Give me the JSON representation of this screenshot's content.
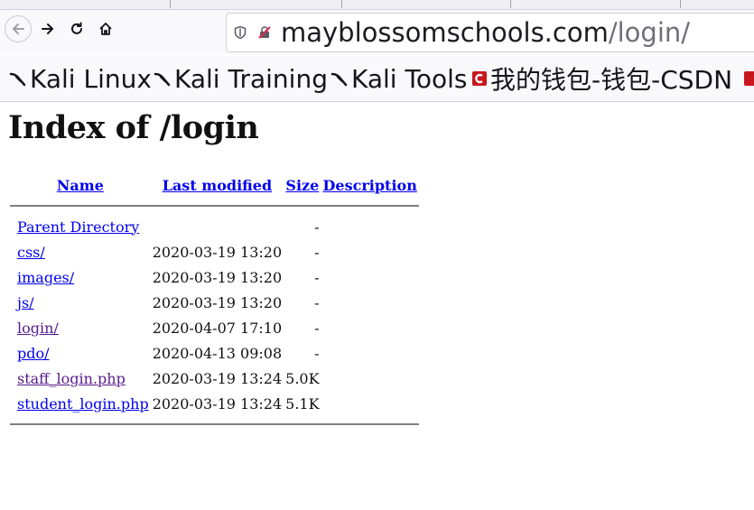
{
  "browser": {
    "url_host": "mayblossomschools.com",
    "url_path": "/login/",
    "bookmarks": [
      {
        "label": "Kali Linux",
        "icon": "kali-dragon-icon"
      },
      {
        "label": "Kali Training",
        "icon": "kali-dragon-icon"
      },
      {
        "label": "Kali Tools",
        "icon": "kali-dragon-icon"
      },
      {
        "label": "我的钱包-钱包-CSDN",
        "icon": "csdn-icon"
      }
    ],
    "colors": {
      "link": "#0000ee",
      "visited": "#551a8b",
      "csdn_red": "#c8161d"
    }
  },
  "page": {
    "title": "Index of /login",
    "columns": {
      "name": "Name",
      "modified": "Last modified",
      "size": "Size",
      "description": "Description"
    },
    "rows": [
      {
        "name": "Parent Directory",
        "modified": "",
        "size": "-",
        "description": ""
      },
      {
        "name": "css/",
        "modified": "2020-03-19 13:20",
        "size": "-",
        "description": ""
      },
      {
        "name": "images/",
        "modified": "2020-03-19 13:20",
        "size": "-",
        "description": ""
      },
      {
        "name": "js/",
        "modified": "2020-03-19 13:20",
        "size": "-",
        "description": ""
      },
      {
        "name": "login/",
        "modified": "2020-04-07 17:10",
        "size": "-",
        "description": ""
      },
      {
        "name": "pdo/",
        "modified": "2020-04-13 09:08",
        "size": "-",
        "description": ""
      },
      {
        "name": "staff_login.php",
        "modified": "2020-03-19 13:24",
        "size": "5.0K",
        "description": ""
      },
      {
        "name": "student_login.php",
        "modified": "2020-03-19 13:24",
        "size": "5.1K",
        "description": ""
      }
    ]
  }
}
